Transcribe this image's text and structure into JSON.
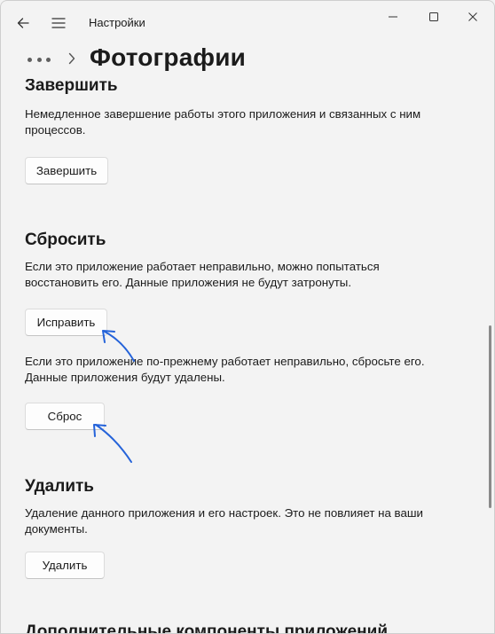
{
  "window": {
    "title": "Настройки"
  },
  "header": {
    "page_title": "Фотографии"
  },
  "sections": {
    "terminate": {
      "title": "Завершить",
      "description": "Немедленное завершение работы этого приложения и связанных с ним процессов.",
      "button": "Завершить"
    },
    "reset": {
      "title": "Сбросить",
      "repair_description": "Если это приложение работает неправильно, можно попытаться восстановить его. Данные приложения не будут затронуты.",
      "repair_button": "Исправить",
      "reset_description": "Если это приложение по-прежнему работает неправильно, сбросьте его. Данные приложения будут удалены.",
      "reset_button": "Сброс"
    },
    "uninstall": {
      "title": "Удалить",
      "description": "Удаление данного приложения и его настроек. Это не повлияет на ваши документы.",
      "button": "Удалить"
    },
    "addons": {
      "title": "Дополнительные компоненты приложений"
    }
  },
  "icons": {
    "back": "back-arrow-icon",
    "menu": "hamburger-menu-icon",
    "minimize": "minimize-icon",
    "maximize": "maximize-icon",
    "close": "close-icon",
    "more": "more-dots-icon",
    "chevron": "chevron-right-icon"
  },
  "colors": {
    "annotation_arrow": "#2563d9"
  }
}
